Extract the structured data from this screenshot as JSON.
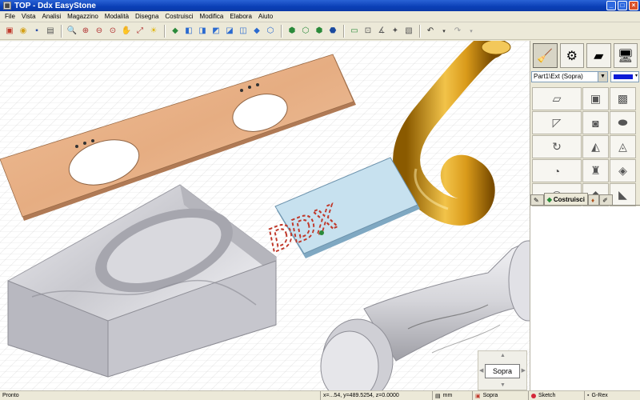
{
  "window": {
    "title": "TOP - Ddx EasyStone",
    "app_icon": "easystone-app-icon"
  },
  "menu": [
    "File",
    "Vista",
    "Analisi",
    "Magazzino",
    "Modalità",
    "Disegna",
    "Costruisci",
    "Modifica",
    "Elabora",
    "Aiuto"
  ],
  "panel": {
    "combo_value": "Part1\\Ext (Sopra)",
    "color": "#0d1bd6",
    "tabs": [
      "",
      "Costruisci",
      "",
      ""
    ]
  },
  "navcube": {
    "face": "Sopra"
  },
  "status": {
    "ready": "Pronto",
    "coords": "x=...54, y=489.5254, z=0.0000",
    "unit": "mm",
    "view": "Sopra",
    "sketch": "Sketch",
    "grex": "G-Rex"
  },
  "scene": {
    "ddx_text": "DDX",
    "colors": {
      "worktop": "#e8b48a",
      "handrail": "#d99a1a",
      "marble": "#d8d8dc",
      "plate": "#c7e1ef"
    }
  }
}
